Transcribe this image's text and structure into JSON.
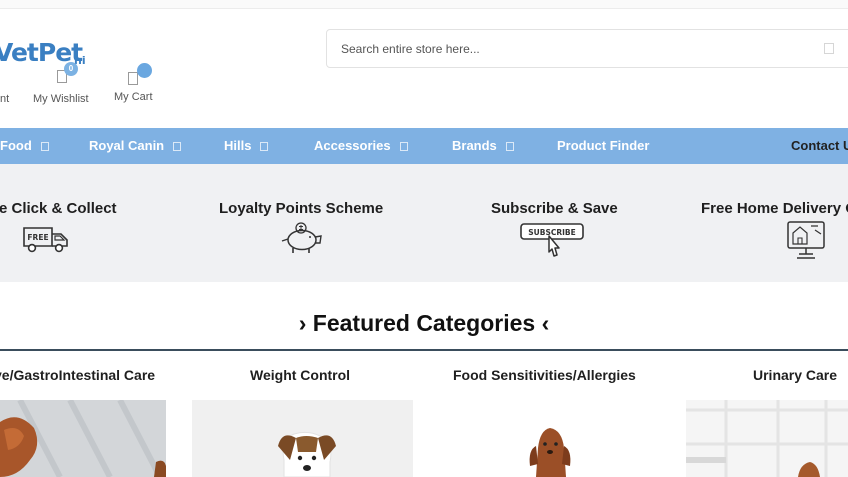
{
  "header": {
    "logo_text": "VetPet",
    "logo_sub": "ni",
    "search_placeholder": "Search entire store here...",
    "account_label": "nt",
    "wishlist_label": "My Wishlist",
    "wishlist_count": "0",
    "cart_label": "My Cart"
  },
  "nav": {
    "items": [
      {
        "label": "Food"
      },
      {
        "label": "Royal Canin"
      },
      {
        "label": "Hills"
      },
      {
        "label": "Accessories"
      },
      {
        "label": "Brands"
      },
      {
        "label": "Product Finder"
      },
      {
        "label": "Contact U"
      }
    ]
  },
  "features": [
    {
      "title": "e Click & Collect",
      "icon": "free-truck-icon"
    },
    {
      "title": "Loyalty Points Scheme",
      "icon": "piggy-bank-icon"
    },
    {
      "title": "Subscribe & Save",
      "icon": "subscribe-button-icon",
      "icon_text": "SUBSCRIBE"
    },
    {
      "title": "Free Home Delivery O",
      "icon": "home-delivery-icon"
    }
  ],
  "free_badge_text": "FREE",
  "featured": {
    "heading": "› Featured Categories ‹",
    "categories": [
      {
        "title": "ve/GastroIntestinal Care"
      },
      {
        "title": "Weight Control"
      },
      {
        "title": "Food Sensitivities/Allergies"
      },
      {
        "title": "Urinary Care"
      }
    ]
  },
  "colors": {
    "brand_blue": "#3a7fc2",
    "nav_bg": "#7fb1e3",
    "features_bg": "#f0f1f3",
    "heading_rule": "#3a4d5c"
  }
}
